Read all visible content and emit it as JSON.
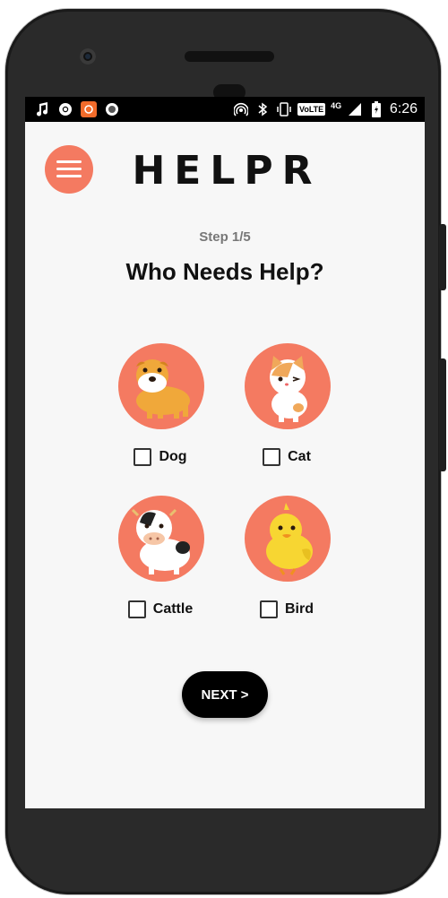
{
  "status_bar": {
    "time": "6:26",
    "network_label": "4G",
    "volte_label": "VoLTE",
    "icons": [
      "music-icon",
      "chrome-icon",
      "app-icon",
      "record-icon",
      "hotspot-icon",
      "bluetooth-icon",
      "vibrate-icon",
      "volte-icon",
      "signal-icon",
      "battery-icon"
    ]
  },
  "header": {
    "menu_icon": "hamburger-icon",
    "logo_text": "HELPR"
  },
  "content": {
    "step_label": "Step 1/5",
    "title": "Who Needs Help?",
    "animals": [
      {
        "label": "Dog",
        "checked": false
      },
      {
        "label": "Cat",
        "checked": false
      },
      {
        "label": "Cattle",
        "checked": false
      },
      {
        "label": "Bird",
        "checked": false
      }
    ],
    "next_label": "NEXT >"
  },
  "colors": {
    "accent": "#f47a61",
    "background": "#f7f7f7",
    "button": "#000000"
  }
}
